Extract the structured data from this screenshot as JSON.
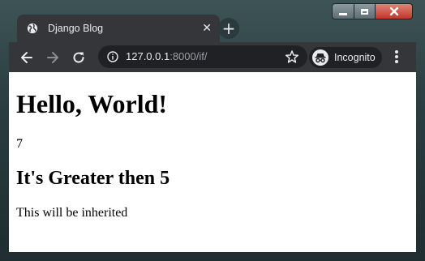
{
  "window": {
    "controls": [
      "minimize",
      "maximize",
      "close"
    ]
  },
  "tab": {
    "title": "Django Blog",
    "icon": "globe-icon",
    "close_glyph": "✕"
  },
  "newtab": {
    "glyph": "+"
  },
  "toolbar": {
    "url_host": "127.0.0.1",
    "url_rest": ":8000/if/",
    "incognito_label": "Incognito"
  },
  "page": {
    "heading": "Hello, World!",
    "number": "7",
    "subheading": "It's Greater then 5",
    "paragraph": "This will be inherited"
  },
  "colors": {
    "toolbar_bg": "#35363a",
    "omnibox_bg": "#202124",
    "close_red": "#c0392b"
  }
}
